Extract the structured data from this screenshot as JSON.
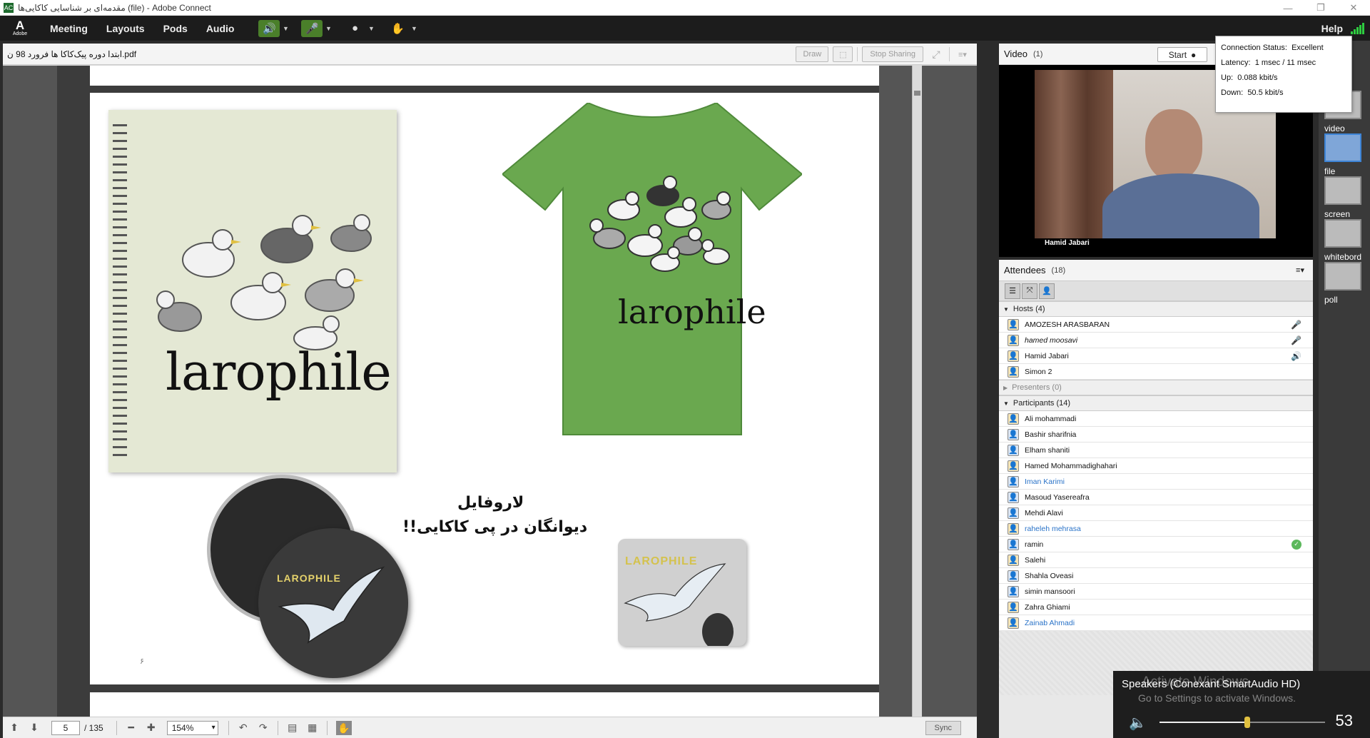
{
  "window": {
    "title": "مقدمه‌ای بر شناسایی کاکایی‌ها (file) - Adobe Connect",
    "app_icon": "AC",
    "minimize": "—",
    "maximize": "❐",
    "close": "✕"
  },
  "menubar": {
    "logo": "A",
    "logo_sub": "Adobe",
    "items": [
      "Meeting",
      "Layouts",
      "Pods",
      "Audio"
    ],
    "help": "Help"
  },
  "share": {
    "filename": "ابتدا دوره پیک‌کاکا ها فرورد 98 ن.pdf",
    "draw": "Draw",
    "stop_sharing": "Stop Sharing",
    "page": "5",
    "total": "/ 135",
    "zoom": "154%",
    "sync": "Sync"
  },
  "slide": {
    "notebook_word": "larophile",
    "shirt_word": "larophile",
    "badge_word": "LAROPHILE",
    "pad_word": "LAROPHILE",
    "caption_line1": "لاروفایل",
    "caption_line2": "دیوانگان در پی کاکایی!!",
    "page_mark": "۶",
    "shirt_color": "#6aa84f"
  },
  "video": {
    "title": "Video",
    "count": "(1)",
    "start": "Start",
    "person": "Hamid Jabari"
  },
  "connection": {
    "status_label": "Connection Status:",
    "status": "Excellent",
    "latency_label": "Latency:",
    "latency": "1 msec / 11 msec",
    "up_label": "Up:",
    "up": "0.088 kbit/s",
    "down_label": "Down:",
    "down": "50.5 kbit/s"
  },
  "attendees": {
    "title": "Attendees",
    "count": "(18)",
    "hosts_label": "Hosts (4)",
    "presenters_label": "Presenters (0)",
    "participants_label": "Participants (14)",
    "hosts": [
      {
        "name": "AMOZESH ARASBARAN",
        "status": "mic-off"
      },
      {
        "name": "hamed moosavi",
        "status": "mic-off"
      },
      {
        "name": "Hamid Jabari",
        "status": "speaking"
      },
      {
        "name": "Simon 2",
        "status": ""
      }
    ],
    "participants": [
      "Ali mohammadi",
      "Bashir sharifnia",
      "Elham shaniti",
      "Hamed Mohammadighahari",
      "Iman Karimi",
      "Masoud Yasereafra",
      "Mehdi Alavi",
      "raheleh mehrasa",
      "ramin",
      "Salehi",
      "Shahla Oveasi",
      "simin mansoori",
      "Zahra Ghiami",
      "Zainab Ahmadi"
    ]
  },
  "rail": {
    "labels": [
      "video",
      "file",
      "screen",
      "whitebord",
      "poll"
    ]
  },
  "toast": {
    "device": "Speakers (Conexant SmartAudio HD)",
    "wm1": "Activate Windows",
    "wm2": "Go to Settings to activate Windows.",
    "volume": "53",
    "volume_fraction": 0.53
  }
}
